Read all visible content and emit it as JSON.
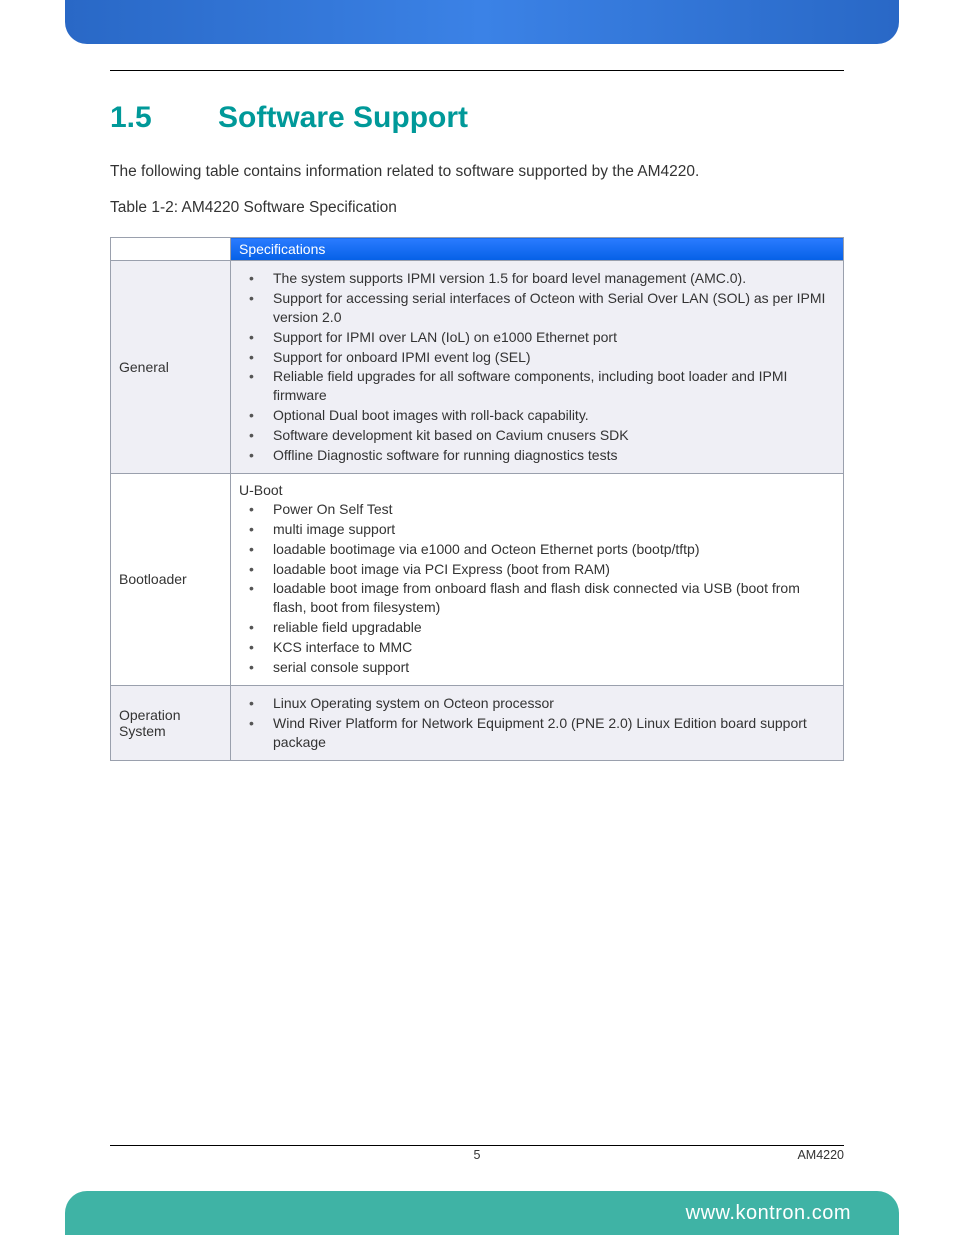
{
  "heading": {
    "number": "1.5",
    "title": "Software Support"
  },
  "lead": "The following table contains information related to software supported by the AM4220.",
  "table_caption": "Table 1-2: AM4220 Software Specification",
  "table": {
    "header": {
      "col1": "",
      "col2": "Specifications"
    },
    "rows": [
      {
        "category": "General",
        "prelabel": "",
        "items": [
          "The system supports IPMI version 1.5 for board level management (AMC.0).",
          "Support for accessing serial interfaces of Octeon with Serial Over LAN (SOL) as per IPMI version 2.0",
          "Support for IPMI over LAN (IoL) on e1000 Ethernet port",
          "Support for onboard IPMI event log (SEL)",
          "Reliable field upgrades for all software components, including boot loader and IPMI firmware",
          "Optional Dual boot images with roll-back capability.",
          "Software development kit based on Cavium cnusers SDK",
          "Offline Diagnostic software for running diagnostics tests"
        ]
      },
      {
        "category": "Bootloader",
        "prelabel": "U-Boot",
        "items": [
          "Power On Self Test",
          "multi image support",
          "loadable bootimage via e1000 and Octeon Ethernet ports (bootp/tftp)",
          "loadable boot image via PCI Express (boot from RAM)",
          "loadable boot image from onboard flash and flash disk connected via USB (boot from flash, boot from filesystem)",
          "reliable field upgradable",
          "KCS interface to MMC",
          "serial console support"
        ]
      },
      {
        "category": "Operation System",
        "prelabel": "",
        "items": [
          "Linux Operating system on Octeon processor",
          "Wind River Platform for Network Equipment 2.0 (PNE 2.0) Linux Edition board support package"
        ]
      }
    ]
  },
  "footer": {
    "page_number": "5",
    "doc_id": "AM4220",
    "url": "www.kontron.com"
  }
}
